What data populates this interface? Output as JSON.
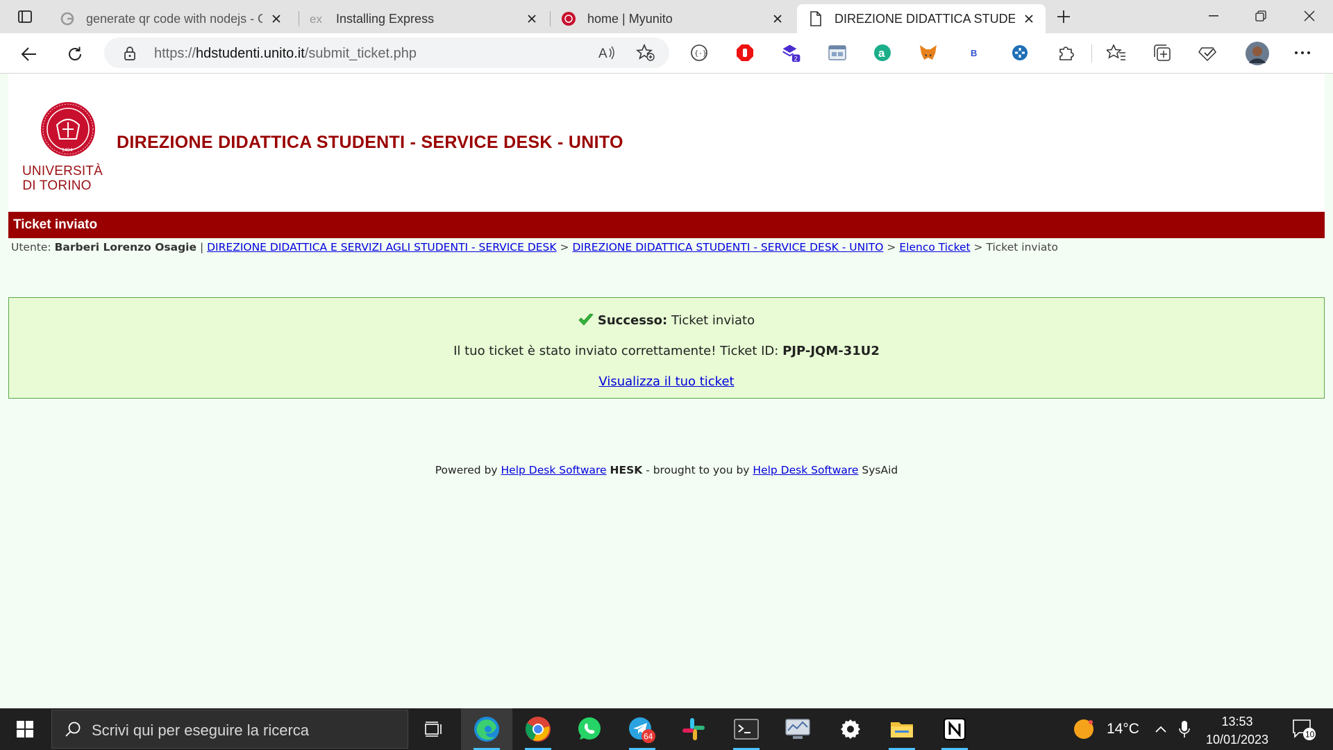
{
  "browser": {
    "tabs": [
      {
        "title": "generate qr code with nodejs - G",
        "favicon": "google-icon"
      },
      {
        "title": "Installing Express",
        "favicon": "express-icon"
      },
      {
        "title": "home | Myunito",
        "favicon": "unito-icon"
      },
      {
        "title": "DIREZIONE DIDATTICA STUDENT",
        "favicon": "page-icon",
        "active": true
      }
    ],
    "url": {
      "scheme": "https://",
      "host": "hdstudenti.unito.it",
      "path": "/submit_ticket.php"
    },
    "extension_badge": "2",
    "extension_b_label": "B"
  },
  "page": {
    "logo": {
      "line1": "UNIVERSITÀ",
      "line2": "DI TORINO",
      "seal_year": "1404"
    },
    "site_title": "DIREZIONE DIDATTICA STUDENTI - SERVICE DESK - UNITO",
    "title_bar": "Ticket inviato",
    "breadcrumb": {
      "user_label": "Utente:",
      "user_name": "Barberi Lorenzo Osagie",
      "sep_bar": "|",
      "link1": "DIREZIONE DIDATTICA E SERVIZI AGLI STUDENTI - SERVICE DESK",
      "arrow": ">",
      "link2": "DIREZIONE DIDATTICA STUDENTI - SERVICE DESK - UNITO",
      "link3": "Elenco Ticket",
      "current": "Ticket inviato"
    },
    "success": {
      "label": "Successo:",
      "text": "Ticket inviato",
      "message": "Il tuo ticket è stato inviato correttamente! Ticket ID:",
      "ticket_id": "PJP-JQM-31U2",
      "view_link": "Visualizza il tuo ticket"
    },
    "footer": {
      "powered_by": "Powered by",
      "link1": "Help Desk Software",
      "hesk": "HESK",
      "brought": "- brought to you by",
      "link2": "Help Desk Software",
      "sysaid": "SysAid"
    }
  },
  "taskbar": {
    "search_placeholder": "Scrivi qui per eseguire la ricerca",
    "telegram_badge": "64",
    "temperature": "14°C",
    "time": "13:53",
    "date": "10/01/2023",
    "notification_count": "10"
  },
  "colors": {
    "accent_red": "#9a0000",
    "success_bg": "#e8fbd4",
    "page_bg": "#f3fdf3"
  }
}
